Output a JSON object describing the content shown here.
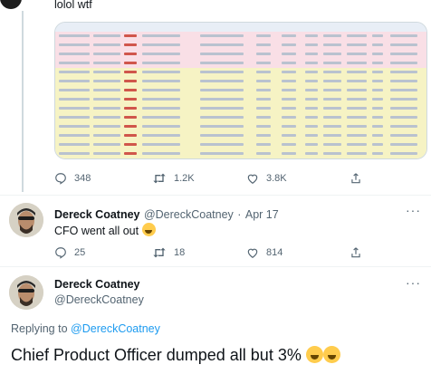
{
  "tweet_top": {
    "text": "lolol wtf",
    "stats": {
      "replies": "348",
      "retweets": "1.2K",
      "likes": "3.8K"
    }
  },
  "tweet_cfo": {
    "display_name": "Dereck Coatney",
    "handle": "@DereckCoatney",
    "separator": "·",
    "date": "Apr 17",
    "text": "CFO went all out",
    "emoji": "rofl",
    "stats": {
      "replies": "25",
      "retweets": "18",
      "likes": "814"
    },
    "more": "···"
  },
  "tweet_focus": {
    "display_name": "Dereck Coatney",
    "handle": "@DereckCoatney",
    "reply_prefix": "Replying to",
    "reply_handle": "@DereckCoatney",
    "text": "Chief Product Officer dumped all but 3%",
    "emoji": [
      "rofl",
      "rofl"
    ],
    "more": "···"
  },
  "colors": {
    "text": "#0f1419",
    "muted": "#536471",
    "link": "#1d9bf0",
    "table_row_pink": "#f9dfe6",
    "table_row_yellow": "#f6f3c4",
    "table_header": "#e8eef6"
  },
  "icons": [
    "reply-icon",
    "retweet-icon",
    "like-icon",
    "share-icon",
    "more-icon",
    "rofl-emoji"
  ]
}
